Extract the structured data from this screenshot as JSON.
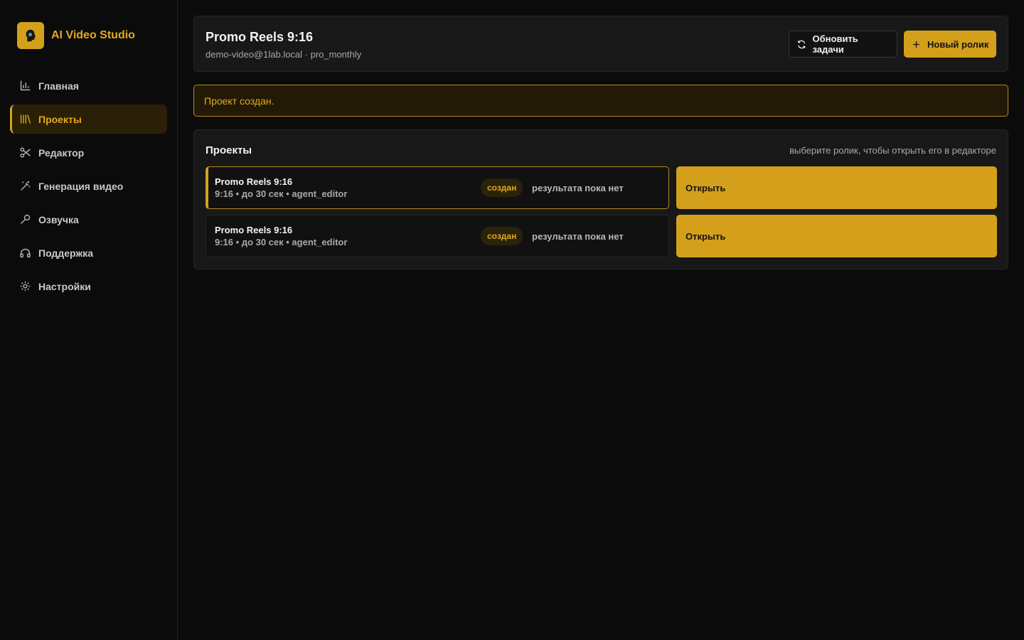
{
  "app": {
    "title": "AI Video Studio",
    "logo_icon": "head-icon",
    "accent_color": "#d4a01c"
  },
  "sidebar": {
    "items": [
      {
        "label": "Главная",
        "icon": "bar-chart-icon",
        "active": false
      },
      {
        "label": "Проекты",
        "icon": "library-icon",
        "active": true
      },
      {
        "label": "Редактор",
        "icon": "scissors-icon",
        "active": false
      },
      {
        "label": "Генерация видео",
        "icon": "magic-wand-icon",
        "active": false
      },
      {
        "label": "Озвучка",
        "icon": "microphone-icon",
        "active": false
      },
      {
        "label": "Поддержка",
        "icon": "headphones-icon",
        "active": false
      },
      {
        "label": "Настройки",
        "icon": "gear-icon",
        "active": false
      }
    ]
  },
  "header": {
    "title": "Promo Reels 9:16",
    "subtitle": "demo-video@1lab.local · pro_monthly",
    "refresh_label": "Обновить задачи",
    "new_label": "Новый ролик"
  },
  "alert": {
    "message": "Проект создан."
  },
  "projects": {
    "title": "Проекты",
    "hint": "выберите ролик, чтобы открыть его в редакторе",
    "rows": [
      {
        "name": "Promo Reels 9:16",
        "meta": "9:16 • до 30 сек • agent_editor",
        "status": "создан",
        "result": "результата пока нет",
        "open_label": "Открыть",
        "selected": true
      },
      {
        "name": "Promo Reels 9:16",
        "meta": "9:16 • до 30 сек • agent_editor",
        "status": "создан",
        "result": "результата пока нет",
        "open_label": "Открыть",
        "selected": false
      }
    ]
  }
}
